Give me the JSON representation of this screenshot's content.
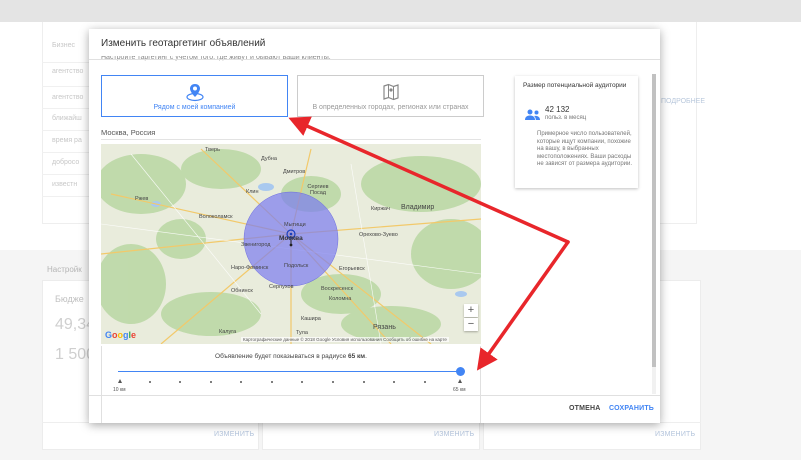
{
  "background": {
    "rows": [
      "Бизнес",
      "агентство",
      "агентство",
      "агентство",
      "ближайш",
      "время ра",
      "добросо",
      "известн"
    ],
    "right_link": "ПОДРОБНЕЕ",
    "section_title": "Настройк",
    "budget_label": "Бюдже",
    "budget_value1": "49,34",
    "budget_value2": "1 500",
    "edit_label": "ИЗМЕНИТЬ"
  },
  "dialog": {
    "title": "Изменить геотаргетинг объявлений",
    "cut_text": "Настройте таргетинг с учетом того, где живут и бывают ваши клиенты.",
    "option_near": "Рядом с моей компанией",
    "option_regions": "В определенных городах, регионах или странах",
    "location": "Москва, Россия",
    "map": {
      "labels": {
        "tver": "Тверь",
        "klin": "Клин",
        "sergiev": "Сергиев Посад",
        "rzhev": "Ржев",
        "volokolamsk": "Волоколамск",
        "zvenigorod": "Звенигород",
        "mytishchi": "Мытищи",
        "moskva": "Москва",
        "orekhovo": "Орехово-Зуево",
        "naro": "Наро-Фоминск",
        "podolsk": "Подольск",
        "egorevsk": "Егорьевск",
        "voskresensk": "Воскресенск",
        "obninsk": "Обнинск",
        "serpukhov": "Серпухов",
        "kolomna": "Коломна",
        "vladimir": "Владимир",
        "kaluga": "Калуга",
        "tula": "Тула",
        "ryazan": "Рязань",
        "kashira": "Кашира",
        "kirzhach": "Киржач",
        "dubna": "Дубна",
        "dmitrov": "Дмитров"
      },
      "footer": "Картографические данные © 2018 Google   Условия использования   Сообщить об ошибке на карте",
      "google": "Google",
      "zoom_in": "+",
      "zoom_out": "−"
    },
    "radius_prefix": "Объявление будет показываться в радиусе ",
    "radius_value": "65 км",
    "radius_suffix": ".",
    "slider_min": "10 км",
    "slider_max": "65 км",
    "audience": {
      "title": "Размер потенциальной аудитории",
      "count": "42 132",
      "unit": "польз. в месяц",
      "description": "Примерное число пользователей, которые ищут компании, похожие на вашу, в выбранных местоположениях. Ваши расходы не зависят от размера аудитории."
    },
    "cancel": "ОТМЕНА",
    "save": "СОХРАНИТЬ"
  },
  "colors": {
    "accent": "#4285f4",
    "arrow": "#e8262b",
    "radius_fill": "#7b7cf0"
  }
}
